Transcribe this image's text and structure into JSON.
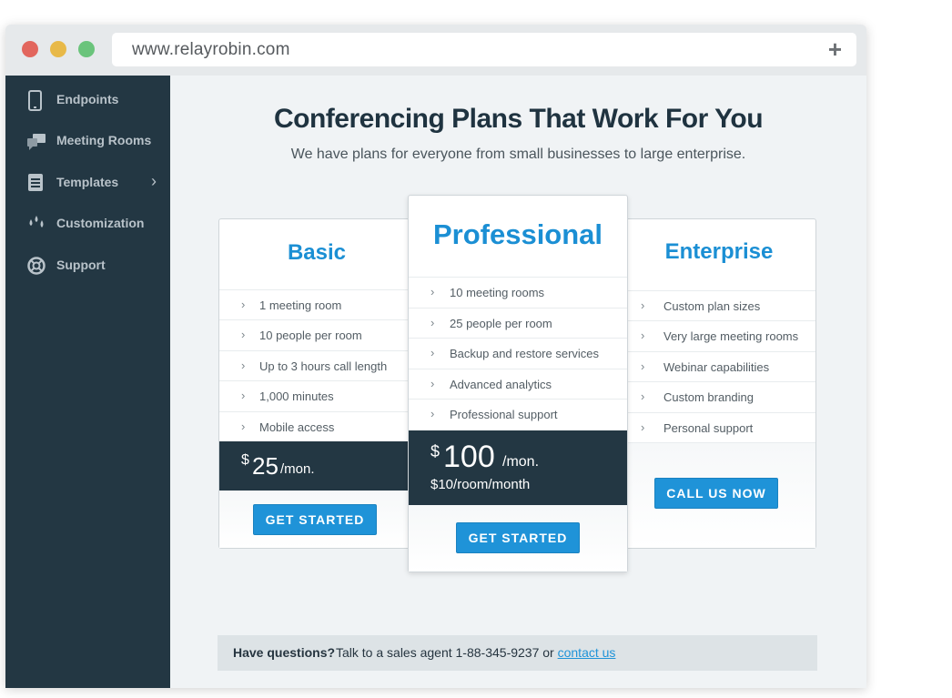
{
  "browser": {
    "url": "www.relayrobin.com",
    "new_tab": "+"
  },
  "sidebar": {
    "items": [
      {
        "label": "Endpoints"
      },
      {
        "label": "Meeting Rooms"
      },
      {
        "label": "Templates",
        "has_submenu": true
      },
      {
        "label": "Customization"
      },
      {
        "label": "Support"
      }
    ]
  },
  "page": {
    "title": "Conferencing Plans That Work For You",
    "subtitle": "We have plans for everyone from small businesses to large enterprise."
  },
  "plans": {
    "basic": {
      "name": "Basic",
      "features": [
        "1 meeting room",
        "10 people per room",
        "Up to 3 hours call length",
        "1,000 minutes",
        "Mobile access"
      ],
      "currency": "$",
      "price": "25",
      "period": "/mon.",
      "button": "GET STARTED"
    },
    "professional": {
      "name": "Professional",
      "features": [
        "10 meeting rooms",
        "25 people per room",
        "Backup and restore services",
        "Advanced analytics",
        "Professional support"
      ],
      "currency": "$",
      "price": "100",
      "period": "/mon.",
      "per_room": "$10/room/month",
      "button": "GET STARTED"
    },
    "enterprise": {
      "name": "Enterprise",
      "features": [
        "Custom plan sizes",
        "Very large meeting rooms",
        "Webinar capabilities",
        "Custom branding",
        "Personal support"
      ],
      "button": "CALL US NOW"
    }
  },
  "help": {
    "question": "Have questions?",
    "text": "Talk to a sales agent 1-88-345-9237 or",
    "link": "contact us"
  },
  "colors": {
    "accent": "#1f93d8",
    "sidebar": "#233743",
    "heading": "#1f3340"
  }
}
